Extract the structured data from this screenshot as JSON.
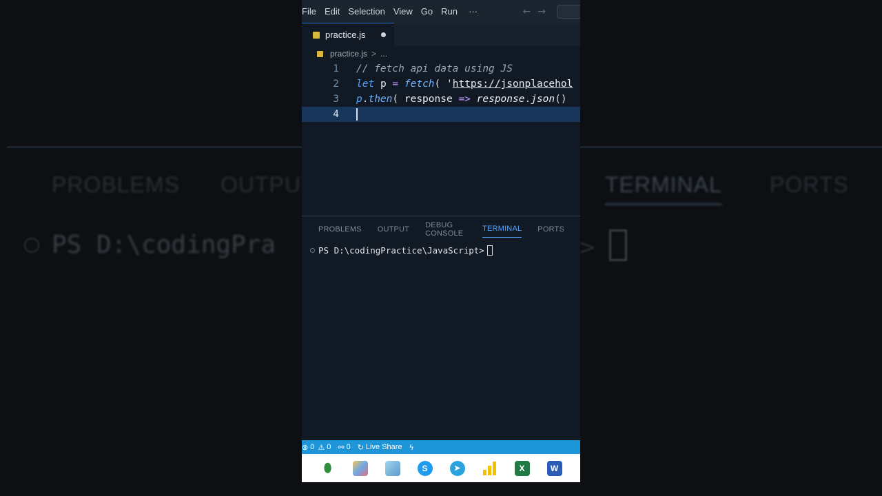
{
  "background": {
    "tabs": [
      "PROBLEMS",
      "OUTPUT",
      "TERMINAL",
      "PORTS"
    ],
    "prompt": "PS D:\\codingPra"
  },
  "menu": {
    "items": [
      "File",
      "Edit",
      "Selection",
      "View",
      "Go",
      "Run",
      "···"
    ],
    "back_icon": "arrow-left-icon",
    "forward_icon": "arrow-right-icon"
  },
  "tab": {
    "filename": "practice.js",
    "modified": true
  },
  "breadcrumb": {
    "file": "practice.js",
    "separator": ">",
    "more": "..."
  },
  "editor": {
    "lines": [
      {
        "number": "1",
        "comment": "// fetch api data using JS"
      },
      {
        "number": "2",
        "kw": "let",
        "var": "p",
        "op": "=",
        "fn": "fetch",
        "open": "(",
        "quote": "'",
        "url": "https://jsonplacehol"
      },
      {
        "number": "3",
        "obj": "p",
        "dot": ".",
        "method": "then",
        "open": "(",
        "param": "response",
        "arrow": "=>",
        "obj2": "response",
        "dot2": ".",
        "method2": "json",
        "call": "()"
      },
      {
        "number": "4"
      }
    ],
    "current_line": 4
  },
  "panel": {
    "tabs": [
      "PROBLEMS",
      "OUTPUT",
      "DEBUG CONSOLE",
      "TERMINAL",
      "PORTS"
    ],
    "active_tab": "TERMINAL",
    "terminal_prompt": "PS D:\\codingPractice\\JavaScript>"
  },
  "statusbar": {
    "errors": "0",
    "warnings": "0",
    "ports": "0",
    "live_share": "Live Share"
  },
  "taskbar": {
    "apps": [
      "mongodb-compass-icon",
      "paint-icon",
      "notepad-icon",
      "skype-icon",
      "telegram-icon",
      "power-bi-icon",
      "excel-icon",
      "word-icon"
    ],
    "labels": {
      "skype": "S",
      "excel": "X",
      "word": "W"
    }
  },
  "colors": {
    "editor_bg": "#111a24",
    "accent": "#4fa3ff",
    "statusbar": "#1e95d9",
    "current_line": "#17365a"
  }
}
